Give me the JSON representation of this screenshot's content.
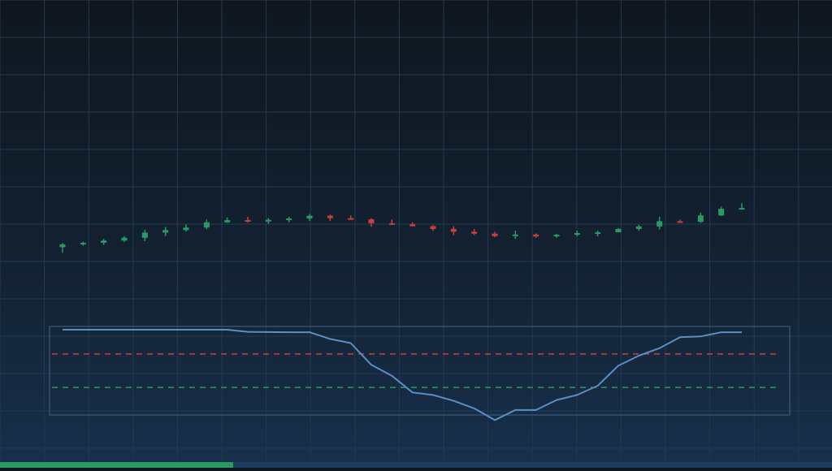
{
  "colors": {
    "up": "#2a9a63",
    "down": "#c9403a",
    "grid": "#243a52",
    "oscillator_line": "#5b8ec2",
    "panel_border": "#3d5c7c",
    "overbought": "#c9403a",
    "oversold": "#2a9a63",
    "progress_track": "#1c3b5e",
    "progress_fill": "#2a9a63"
  },
  "progress": {
    "fraction": 0.28
  },
  "chart_data": [
    {
      "type": "candlestick",
      "title": "",
      "xlabel": "",
      "ylabel": "",
      "grid": true,
      "ylim": [
        0,
        100
      ],
      "candles": [
        {
          "o": 34.0,
          "h": 35.5,
          "l": 32.0,
          "c": 35.0
        },
        {
          "o": 35.0,
          "h": 36.0,
          "l": 34.5,
          "c": 35.6
        },
        {
          "o": 35.6,
          "h": 37.0,
          "l": 34.8,
          "c": 36.4
        },
        {
          "o": 36.4,
          "h": 38.0,
          "l": 35.9,
          "c": 37.4
        },
        {
          "o": 37.4,
          "h": 40.3,
          "l": 36.2,
          "c": 39.3
        },
        {
          "o": 39.3,
          "h": 41.3,
          "l": 38.0,
          "c": 40.2
        },
        {
          "o": 40.2,
          "h": 42.2,
          "l": 39.7,
          "c": 41.1
        },
        {
          "o": 41.1,
          "h": 44.0,
          "l": 40.5,
          "c": 43.0
        },
        {
          "o": 43.0,
          "h": 44.8,
          "l": 42.8,
          "c": 43.8
        },
        {
          "o": 43.8,
          "h": 45.0,
          "l": 42.9,
          "c": 43.3
        },
        {
          "o": 43.3,
          "h": 44.5,
          "l": 42.5,
          "c": 43.9
        },
        {
          "o": 43.9,
          "h": 45.0,
          "l": 43.0,
          "c": 44.4
        },
        {
          "o": 44.4,
          "h": 46.0,
          "l": 43.5,
          "c": 45.4
        },
        {
          "o": 45.4,
          "h": 45.8,
          "l": 43.5,
          "c": 44.5
        },
        {
          "o": 44.5,
          "h": 45.5,
          "l": 44.0,
          "c": 44.1
        },
        {
          "o": 44.1,
          "h": 44.5,
          "l": 41.4,
          "c": 42.7
        },
        {
          "o": 42.7,
          "h": 44.0,
          "l": 42.0,
          "c": 42.3
        },
        {
          "o": 42.3,
          "h": 43.0,
          "l": 41.5,
          "c": 41.6
        },
        {
          "o": 41.6,
          "h": 42.0,
          "l": 39.9,
          "c": 40.6
        },
        {
          "o": 40.6,
          "h": 41.6,
          "l": 38.4,
          "c": 39.6
        },
        {
          "o": 39.6,
          "h": 40.6,
          "l": 38.4,
          "c": 38.9
        },
        {
          "o": 38.9,
          "h": 39.6,
          "l": 37.6,
          "c": 38.0
        },
        {
          "o": 38.0,
          "h": 40.0,
          "l": 37.0,
          "c": 38.6
        },
        {
          "o": 38.6,
          "h": 39.0,
          "l": 37.4,
          "c": 37.9
        },
        {
          "o": 37.9,
          "h": 38.8,
          "l": 37.4,
          "c": 38.5
        },
        {
          "o": 38.5,
          "h": 40.0,
          "l": 38.0,
          "c": 39.1
        },
        {
          "o": 39.1,
          "h": 40.0,
          "l": 37.9,
          "c": 39.4
        },
        {
          "o": 39.4,
          "h": 40.9,
          "l": 39.4,
          "c": 40.6
        },
        {
          "o": 40.6,
          "h": 42.1,
          "l": 39.9,
          "c": 41.5
        },
        {
          "o": 41.5,
          "h": 45.0,
          "l": 40.4,
          "c": 43.4
        },
        {
          "o": 43.4,
          "h": 44.0,
          "l": 43.0,
          "c": 43.2
        },
        {
          "o": 43.2,
          "h": 46.5,
          "l": 42.8,
          "c": 45.5
        },
        {
          "o": 45.5,
          "h": 48.7,
          "l": 45.3,
          "c": 47.9
        },
        {
          "o": 47.9,
          "h": 49.9,
          "l": 47.7,
          "c": 48.2
        }
      ]
    },
    {
      "type": "line",
      "title": "",
      "xlabel": "",
      "ylabel": "",
      "ylim": [
        0,
        100
      ],
      "overbought": 70,
      "oversold": 30,
      "values": [
        99,
        99,
        99,
        99,
        99,
        99,
        99,
        99,
        99,
        96.5,
        96.2,
        96,
        96,
        88,
        83,
        57,
        44,
        24,
        21,
        14,
        5,
        -9,
        3,
        3,
        15,
        21,
        32,
        56,
        68,
        77,
        90,
        91,
        96,
        96
      ]
    }
  ]
}
